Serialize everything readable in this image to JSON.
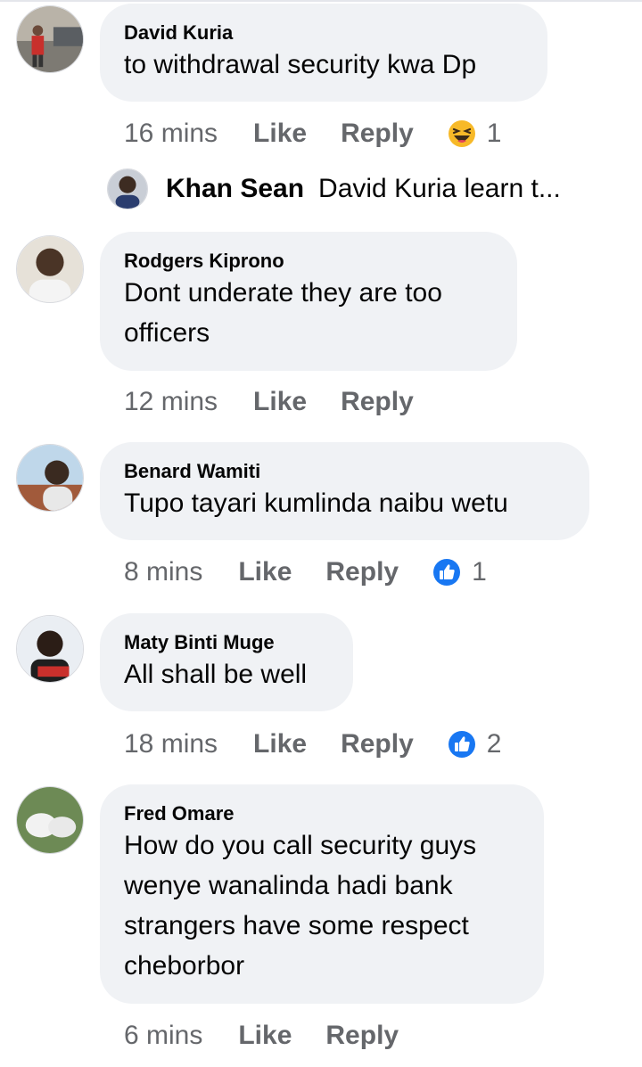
{
  "comments": [
    {
      "name": "David Kuria",
      "lines": [
        "to withdrawal security kwa Dp"
      ],
      "time": "16 mins",
      "like_label": "Like",
      "reply_label": "Reply",
      "reaction": {
        "icon": "haha-emoji-icon",
        "count": "1"
      }
    },
    {
      "name": "Rodgers Kiprono",
      "lines": [
        "Dont  underate  they are too",
        "officers"
      ],
      "time": "12 mins",
      "like_label": "Like",
      "reply_label": "Reply"
    },
    {
      "name": "Benard Wamiti",
      "lines": [
        "Tupo tayari kumlinda naibu wetu"
      ],
      "time": "8 mins",
      "like_label": "Like",
      "reply_label": "Reply",
      "reaction": {
        "icon": "like-thumb-icon",
        "count": "1"
      }
    },
    {
      "name": "Maty Binti Muge",
      "lines": [
        "All shall be well"
      ],
      "time": "18 mins",
      "like_label": "Like",
      "reply_label": "Reply",
      "reaction": {
        "icon": "like-thumb-icon",
        "count": "2"
      }
    },
    {
      "name": "Fred Omare",
      "lines": [
        "How do you call security guys",
        "wenye wanalinda hadi bank",
        "strangers have some respect",
        "cheborbor"
      ],
      "time": "6 mins",
      "like_label": "Like",
      "reply_label": "Reply"
    }
  ],
  "reply_preview": {
    "name": "Khan Sean",
    "text": "David Kuria learn t...",
    "avatar_icon": "user-avatar"
  },
  "colors": {
    "bubble": "#f0f2f5",
    "meta_text": "#65676b",
    "like_blue": "#1877f2",
    "haha_yellow": "#f7b928"
  }
}
